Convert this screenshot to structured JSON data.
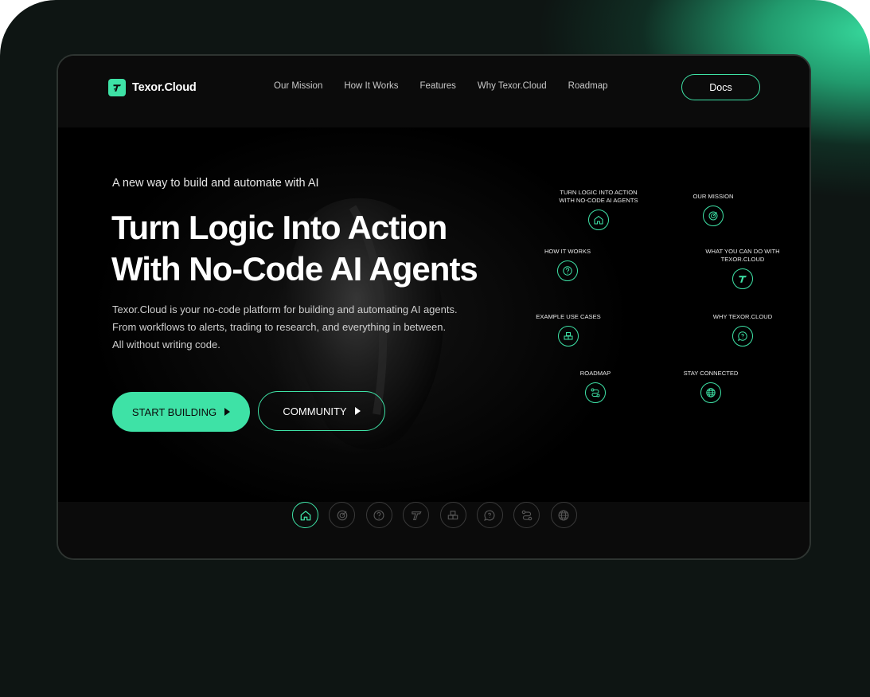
{
  "brand": {
    "name": "Texor.Cloud",
    "accent": "#3ee2a6"
  },
  "nav": {
    "links": [
      "Our Mission",
      "How It Works",
      "Features",
      "Why Texor.Cloud",
      "Roadmap"
    ],
    "docs_label": "Docs"
  },
  "hero": {
    "tagline": "A new way to build and automate with AI",
    "headline": [
      "Turn Logic Into Action",
      "With No-Code AI Agents"
    ],
    "description": [
      "Texor.Cloud is your no-code platform for building and automating AI agents.",
      "From workflows to alerts, trading to research, and everything in between.",
      "All without writing code."
    ],
    "primary_cta": "START BUILDING",
    "secondary_cta": "COMMUNITY"
  },
  "map_nodes": [
    {
      "label": "TURN LOGIC INTO ACTION\nWITH NO-CODE AI AGENTS",
      "icon": "home-icon"
    },
    {
      "label": "OUR MISSION",
      "icon": "target-icon"
    },
    {
      "label": "HOW IT WORKS",
      "icon": "question-icon"
    },
    {
      "label": "WHAT YOU CAN DO WITH\nTEXOR.CLOUD",
      "icon": "texor-logo-icon"
    },
    {
      "label": "EXAMPLE USE CASES",
      "icon": "blocks-icon"
    },
    {
      "label": "WHY TEXOR.CLOUD",
      "icon": "chat-question-icon"
    },
    {
      "label": "ROADMAP",
      "icon": "route-icon"
    },
    {
      "label": "STAY CONNECTED",
      "icon": "globe-icon"
    }
  ],
  "bottom_nav": {
    "active_index": 0,
    "icons": [
      "home-icon",
      "target-icon",
      "question-icon",
      "texor-logo-icon",
      "blocks-icon",
      "chat-question-icon",
      "route-icon",
      "globe-icon"
    ]
  }
}
